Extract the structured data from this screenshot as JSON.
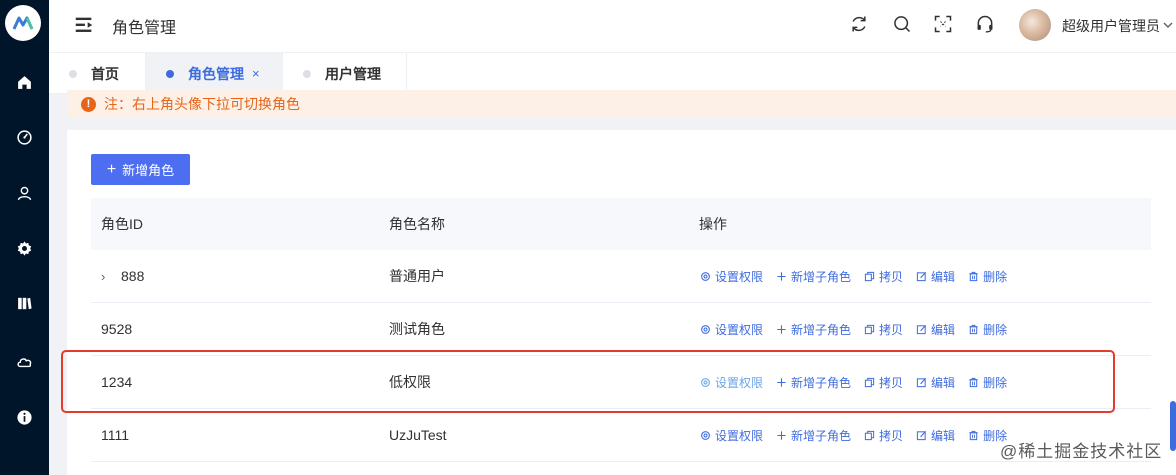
{
  "sidebar": {
    "logo": "logo-icon",
    "items": [
      {
        "icon": "home-icon"
      },
      {
        "icon": "dashboard-icon"
      },
      {
        "icon": "user-icon"
      },
      {
        "icon": "gear-icon"
      },
      {
        "icon": "book-icon"
      },
      {
        "icon": "cloud-icon"
      },
      {
        "icon": "info-icon"
      }
    ]
  },
  "header": {
    "title": "角色管理",
    "user_name": "超级用户管理员",
    "icons": [
      "refresh-icon",
      "search-icon",
      "fullscreen-icon",
      "headset-icon"
    ]
  },
  "tabs": [
    {
      "label": "首页",
      "active": false
    },
    {
      "label": "角色管理",
      "active": true,
      "close": "×"
    },
    {
      "label": "用户管理",
      "active": false
    }
  ],
  "notice": {
    "text": "注：右上角头像下拉可切换角色"
  },
  "toolbar": {
    "add_label": "新增角色",
    "add_icon": "+"
  },
  "table": {
    "columns": [
      "角色ID",
      "角色名称",
      "操作"
    ],
    "rows": [
      {
        "id": "888",
        "name": "普通用户",
        "expandable": true,
        "expand_icon": "›"
      },
      {
        "id": "9528",
        "name": "测试角色",
        "expandable": false
      },
      {
        "id": "1234",
        "name": "低权限",
        "expandable": false
      },
      {
        "id": "1111",
        "name": "UzJuTest",
        "expandable": false
      }
    ],
    "actions": {
      "set_perm": "设置权限",
      "add_child": "新增子角色",
      "copy": "拷贝",
      "edit": "编辑",
      "delete": "删除"
    }
  },
  "watermark": "@稀土掘金技术社区",
  "colors": {
    "primary": "#4e6ef2",
    "link": "#3e6bdf",
    "warning": "#e6651a",
    "highlight": "#e33b2e",
    "sidebar": "#001529"
  }
}
